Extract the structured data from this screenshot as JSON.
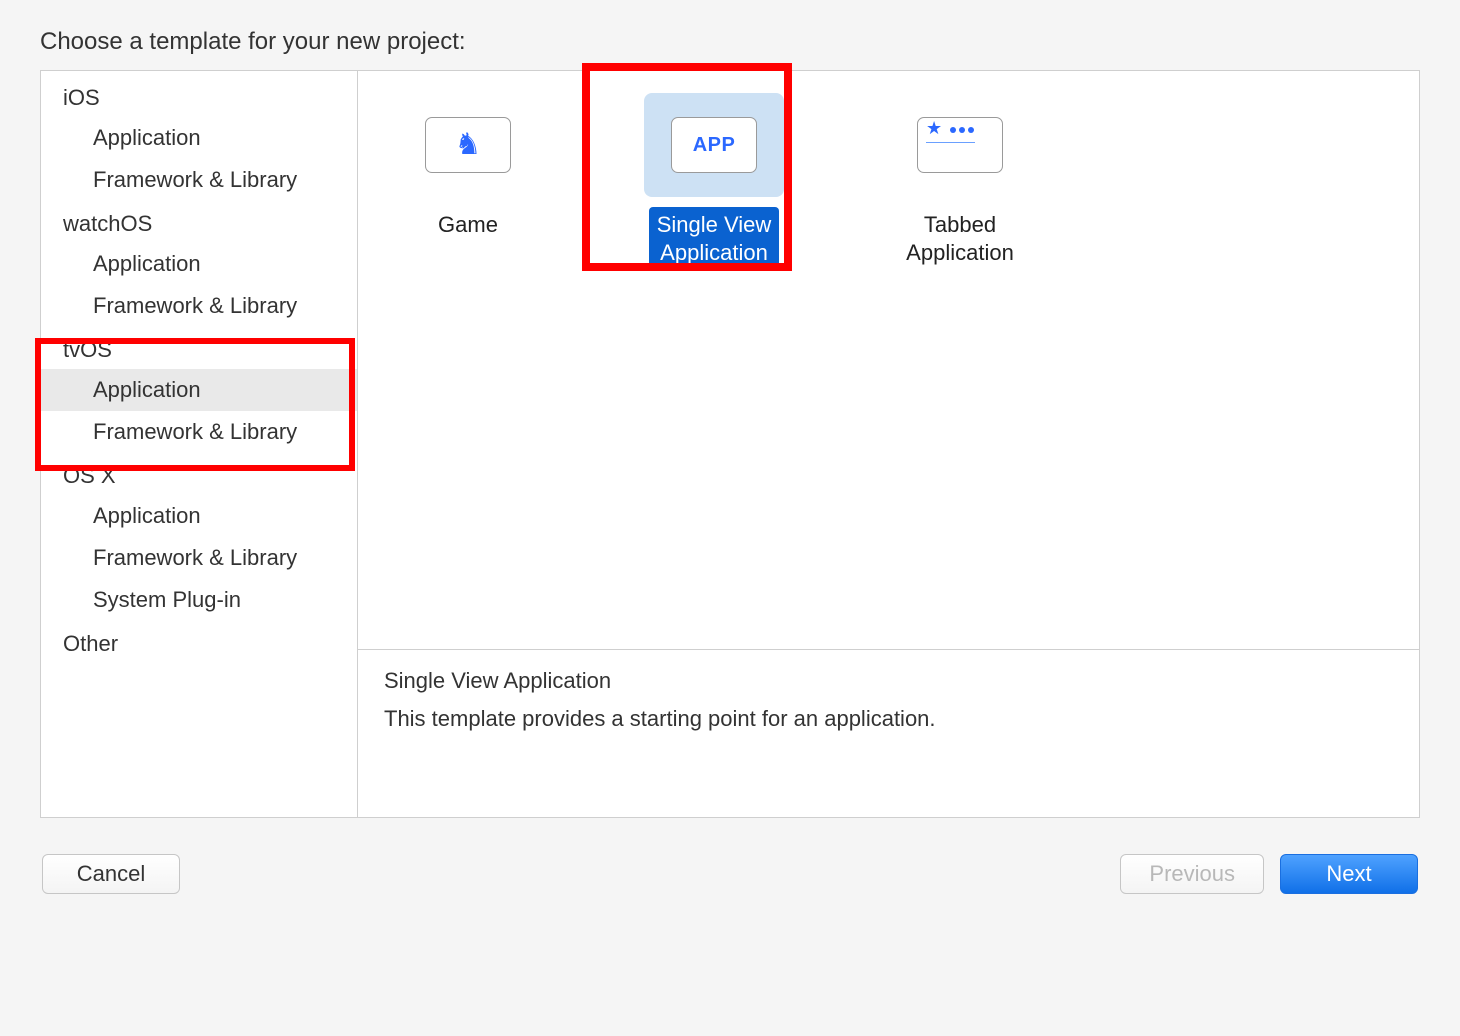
{
  "title": "Choose a template for your new project:",
  "sidebar": {
    "platforms": [
      {
        "name": "iOS",
        "items": [
          "Application",
          "Framework & Library"
        ]
      },
      {
        "name": "watchOS",
        "items": [
          "Application",
          "Framework & Library"
        ]
      },
      {
        "name": "tvOS",
        "items": [
          "Application",
          "Framework & Library"
        ]
      },
      {
        "name": "OS X",
        "items": [
          "Application",
          "Framework & Library",
          "System Plug-in"
        ]
      },
      {
        "name": "Other",
        "items": []
      }
    ],
    "selected_platform": "tvOS",
    "selected_item": "Application"
  },
  "templates": [
    {
      "id": "game",
      "label": "Game"
    },
    {
      "id": "single-view",
      "label": "Single View\nApplication",
      "icon_text": "APP",
      "selected": true
    },
    {
      "id": "tabbed",
      "label": "Tabbed\nApplication"
    }
  ],
  "description": {
    "title": "Single View Application",
    "text": "This template provides a starting point for an application."
  },
  "footer": {
    "cancel": "Cancel",
    "previous": "Previous",
    "next": "Next"
  }
}
